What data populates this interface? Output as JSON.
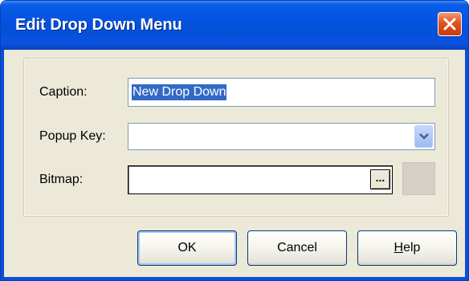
{
  "dialog": {
    "title": "Edit Drop Down Menu",
    "close_icon": "close-icon"
  },
  "form": {
    "caption": {
      "label": "Caption:",
      "value": "New Drop Down"
    },
    "popup_key": {
      "label": "Popup Key:",
      "value": ""
    },
    "bitmap": {
      "label": "Bitmap:",
      "value": "",
      "browse_label": "..."
    }
  },
  "buttons": {
    "ok": "OK",
    "cancel": "Cancel",
    "help_mnemonic": "H",
    "help_rest": "elp"
  },
  "colors": {
    "titlebar": "#0553e0",
    "dialog_bg": "#ece9d8",
    "selection": "#316ac5",
    "close_button": "#e0521f"
  }
}
